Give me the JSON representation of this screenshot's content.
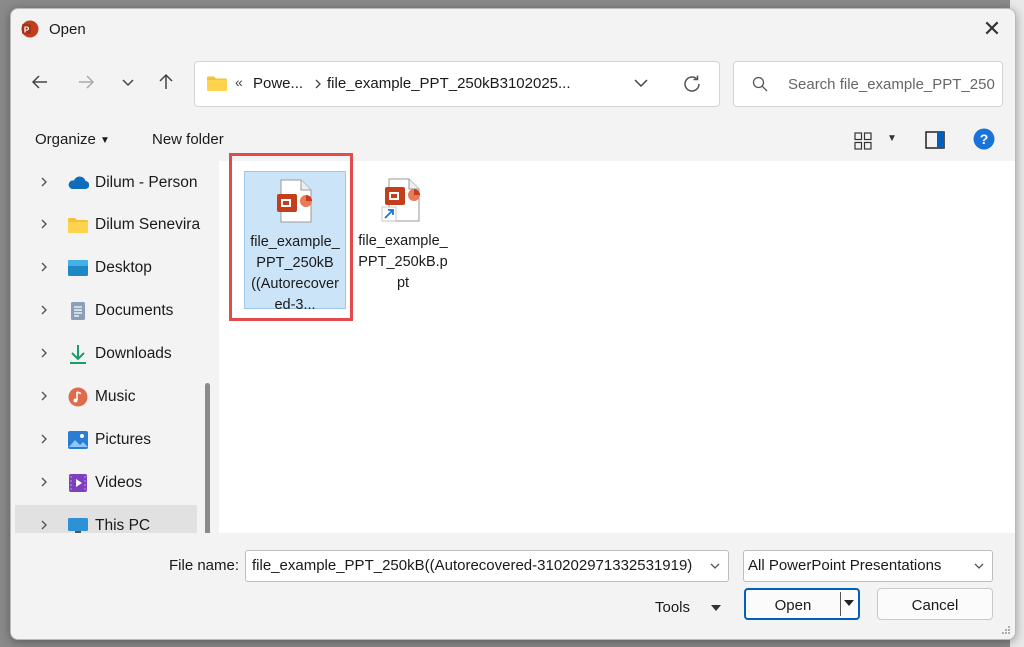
{
  "window": {
    "title": "Open",
    "close_glyph": "✕"
  },
  "nav": {
    "back_icon": "arrow-left-icon",
    "forward_icon": "arrow-right-icon",
    "recent_icon": "chevron-down-icon",
    "up_icon": "arrow-up-icon"
  },
  "address": {
    "overflow": "«",
    "crumbs": [
      "Powe...",
      "file_example_PPT_250kB3102025..."
    ]
  },
  "search": {
    "placeholder": "Search file_example_PPT_250..."
  },
  "toolbar": {
    "organize_label": "Organize",
    "new_folder_label": "New folder"
  },
  "sidebar": {
    "items": [
      {
        "label": "Dilum - Person",
        "icon": "onedrive-cloud-icon"
      },
      {
        "label": "Dilum Senevira",
        "icon": "folder-icon"
      },
      {
        "label": "Desktop",
        "icon": "desktop-icon"
      },
      {
        "label": "Documents",
        "icon": "documents-icon"
      },
      {
        "label": "Downloads",
        "icon": "downloads-icon"
      },
      {
        "label": "Music",
        "icon": "music-icon"
      },
      {
        "label": "Pictures",
        "icon": "pictures-icon"
      },
      {
        "label": "Videos",
        "icon": "videos-icon"
      },
      {
        "label": "This PC",
        "icon": "computer-icon",
        "selected": true
      }
    ]
  },
  "files": [
    {
      "name": "file_example_PPT_250kB((Autorecovered-3...",
      "icon": "powerpoint-file-icon",
      "selected": true
    },
    {
      "name": "file_example_PPT_250kB.ppt",
      "icon": "powerpoint-shortcut-icon",
      "selected": false
    }
  ],
  "bottom": {
    "file_name_label": "File name:",
    "file_name_value": "file_example_PPT_250kB((Autorecovered-310202971332531919)",
    "file_type_value": "All PowerPoint Presentations",
    "tools_label": "Tools",
    "open_label": "Open",
    "cancel_label": "Cancel"
  },
  "colors": {
    "accent": "#005fb8",
    "selection_fill": "#cce4f7",
    "highlight_box": "#e34a4a",
    "powerpoint_red": "#c43e1c"
  }
}
